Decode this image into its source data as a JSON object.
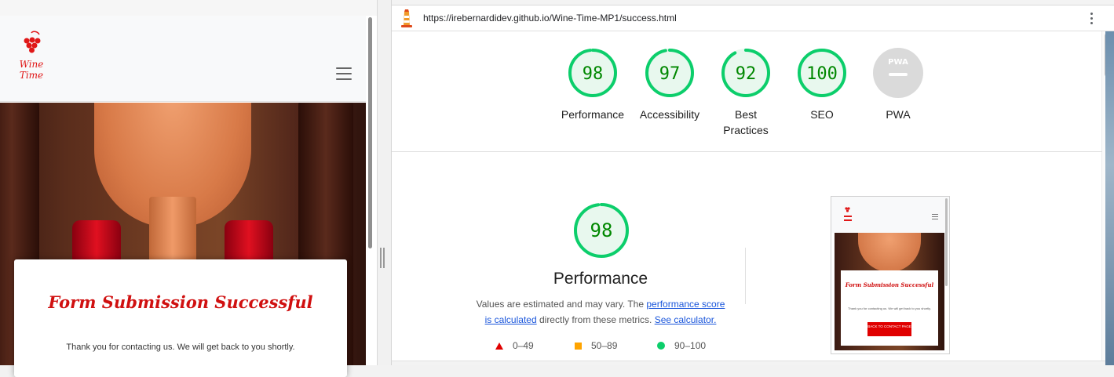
{
  "mobile_preview": {
    "logo_text": "Wine Time",
    "success_card": {
      "title": "Form Submission Successful",
      "message": "Thank you for contacting us. We will get back to you shortly."
    }
  },
  "lighthouse": {
    "url": "https://irebernardidev.github.io/Wine-Time-MP1/success.html",
    "gauges": [
      {
        "label": "Performance",
        "score": "98",
        "fraction": 0.98
      },
      {
        "label": "Accessibility",
        "score": "97",
        "fraction": 0.97
      },
      {
        "label": "Best Practices",
        "score": "92",
        "fraction": 0.92
      },
      {
        "label": "SEO",
        "score": "100",
        "fraction": 1.0
      },
      {
        "label": "PWA",
        "badge": "PWA"
      }
    ],
    "performance": {
      "score": "98",
      "fraction": 0.98,
      "title": "Performance",
      "desc_before": "Values are estimated and may vary. The ",
      "link_score": "performance score is calculated",
      "desc_middle": " directly from these metrics. ",
      "link_calculator": "See calculator."
    },
    "legend": {
      "fail": "0–49",
      "average": "50–89",
      "pass": "90–100"
    },
    "thumbnail": {
      "title": "Form Submission Successful",
      "message": "Thank you for contacting us. We will get back to you shortly.",
      "button": "BACK TO CONTACT PAGE"
    },
    "colors": {
      "pass": "#0cce6b",
      "pass_text": "#008800",
      "average": "#ffa400",
      "fail": "#e00000",
      "gauge_bg": "#e8f8ee"
    }
  }
}
